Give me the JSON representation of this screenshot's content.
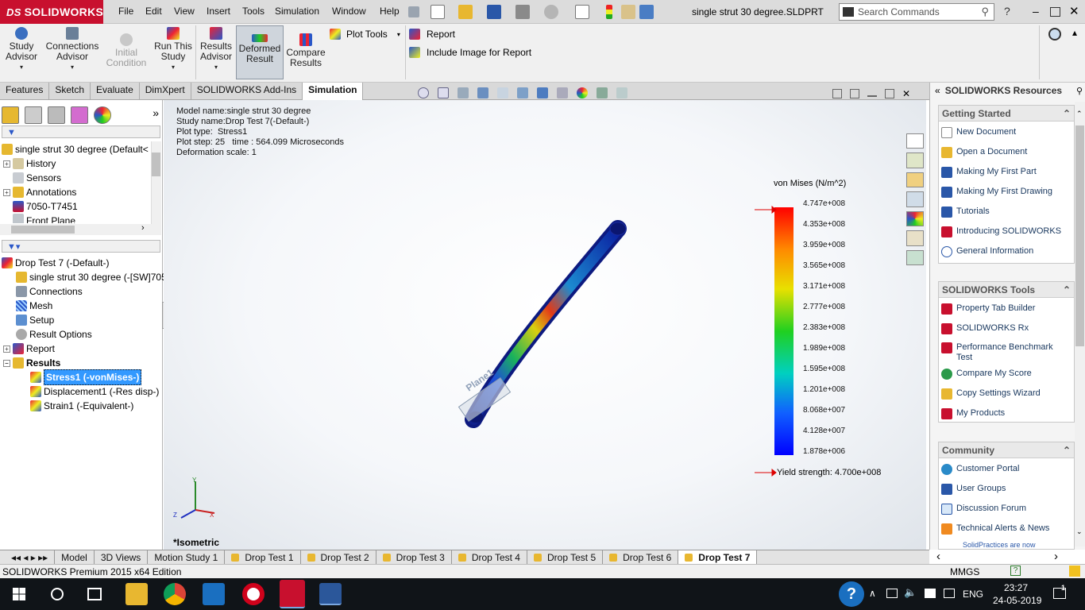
{
  "titlebar": {
    "app_name": "SOLIDWORKS",
    "menus": [
      "File",
      "Edit",
      "View",
      "Insert",
      "Tools",
      "Simulation",
      "Window",
      "Help"
    ],
    "document_title": "single strut 30 degree.SLDPRT",
    "search_placeholder": "Search Commands"
  },
  "ribbon": {
    "study_advisor": "Study\nAdvisor",
    "connections_advisor": "Connections\nAdvisor",
    "initial_condition": "Initial\nCondition",
    "run_study": "Run This\nStudy",
    "results_advisor": "Results\nAdvisor",
    "deformed_result": "Deformed\nResult",
    "compare_results": "Compare\nResults",
    "plot_tools": "Plot Tools",
    "report": "Report",
    "include_image": "Include Image for Report"
  },
  "tabs": [
    "Features",
    "Sketch",
    "Evaluate",
    "DimXpert",
    "SOLIDWORKS Add-Ins",
    "Simulation"
  ],
  "active_tab": "Simulation",
  "feature_tree": {
    "root": "single strut 30 degree  (Default<",
    "items": [
      "History",
      "Sensors",
      "Annotations",
      "7050-T7451",
      "Front Plane"
    ]
  },
  "study_tree": {
    "root": "Drop Test 7 (-Default-)",
    "items": [
      "single strut 30 degree (-[SW]705",
      "Connections",
      "Mesh",
      "Setup",
      "Result Options",
      "Report",
      "Results"
    ],
    "results": [
      "Stress1 (-vonMises-)",
      "Displacement1 (-Res disp-)",
      "Strain1 (-Equivalent-)"
    ]
  },
  "viewport": {
    "info": "Model name:single strut 30 degree\nStudy name:Drop Test 7(-Default-)\nPlot type:  Stress1\nPlot step: 25   time : 564.099 Microseconds\nDeformation scale: 1",
    "legend_title": "von Mises (N/m^2)",
    "legend_ticks": [
      "4.747e+008",
      "4.353e+008",
      "3.959e+008",
      "3.565e+008",
      "3.171e+008",
      "2.777e+008",
      "2.383e+008",
      "1.989e+008",
      "1.595e+008",
      "1.201e+008",
      "8.068e+007",
      "4.128e+007",
      "1.878e+006"
    ],
    "yield_strength": "Yield strength: 4.700e+008",
    "view_name": "*Isometric",
    "plane_label": "Plane1"
  },
  "resources": {
    "title": "SOLIDWORKS Resources",
    "getting_started": {
      "title": "Getting Started",
      "items": [
        "New Document",
        "Open a Document",
        "Making My First Part",
        "Making My First Drawing",
        "Tutorials",
        "Introducing SOLIDWORKS",
        "General Information"
      ]
    },
    "tools": {
      "title": "SOLIDWORKS Tools",
      "items": [
        "Property Tab Builder",
        "SOLIDWORKS Rx",
        "Performance Benchmark Test",
        "Compare My Score",
        "Copy Settings Wizard",
        "My Products"
      ]
    },
    "community": {
      "title": "Community",
      "items": [
        "Customer Portal",
        "User Groups",
        "Discussion Forum",
        "Technical Alerts & News"
      ],
      "footer": "SolidPractices are now"
    }
  },
  "bottom_tabs": [
    "Model",
    "3D Views",
    "Motion Study 1",
    "Drop Test 1",
    "Drop Test 2",
    "Drop Test 3",
    "Drop Test 4",
    "Drop Test 5",
    "Drop Test 6",
    "Drop Test 7"
  ],
  "active_bottom_tab": "Drop Test 7",
  "status": {
    "edition": "SOLIDWORKS Premium 2015 x64 Edition",
    "units": "MMGS"
  },
  "taskbar": {
    "language": "ENG",
    "time": "23:27",
    "date": "24-05-2019",
    "notifications": "1"
  },
  "colors": {
    "brand": "#c8102e",
    "selection": "#3399ff",
    "taskbar": "#101418"
  }
}
